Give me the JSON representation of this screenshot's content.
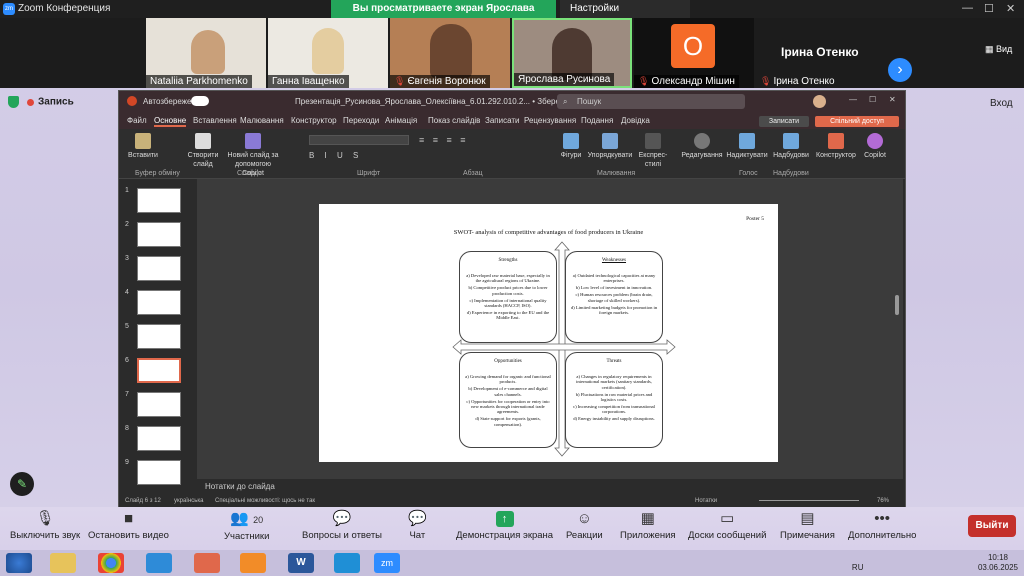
{
  "zoom": {
    "app_title": "Zoom Конференция",
    "share_banner": "Вы просматриваете экран Ярослава Русинова",
    "view_settings": "Настройки просмотра",
    "view_label": "Вид",
    "logo": "zm"
  },
  "participants": [
    {
      "name": "Nataliia Parkhomenko",
      "muted": false
    },
    {
      "name": "Ганна Іващенко",
      "muted": false
    },
    {
      "name": "Євгенія Воронюк",
      "muted": true
    },
    {
      "name": "Ярослава Русинова",
      "muted": false
    },
    {
      "name": "Олександр Мішин",
      "muted": true,
      "avatar_letter": "O"
    },
    {
      "name": "Ірина Отенко",
      "muted": true,
      "big_name": "Ірина Отенко"
    }
  ],
  "recording": {
    "label": "Запись",
    "exit_label": "Вход"
  },
  "ppt": {
    "autosave": "Автозбереження",
    "doc_title": "Презентація_Русинова_Ярослава_Олексіївна_6.01.292.010.2... • Збережено у цей ПК",
    "search": "Пошук",
    "menu": [
      "Файл",
      "Основне",
      "Вставлення",
      "Малювання",
      "Конструктор",
      "Переходи",
      "Анімація",
      "Показ слайдів",
      "Записати",
      "Рецензування",
      "Подання",
      "Довідка"
    ],
    "btn_record": "Записати",
    "btn_share": "Спільний доступ",
    "ribbon": [
      {
        "label": "Вставити"
      },
      {
        "label": "Створити слайд"
      },
      {
        "label": "Новий слайд за допомогою Copilot"
      },
      {
        "label": "Фігури"
      },
      {
        "label": "Упорядкувати"
      },
      {
        "label": "Експрес-стилі"
      },
      {
        "label": "Редагування"
      },
      {
        "label": "Надиктувати"
      },
      {
        "label": "Надбудови"
      },
      {
        "label": "Конструктор"
      },
      {
        "label": "Copilot"
      }
    ],
    "groups": [
      "Буфер обміну",
      "Слайди",
      "Шрифт",
      "Абзац",
      "Малювання",
      "Голос",
      "Надбудови"
    ],
    "slide_numbers": [
      "1",
      "2",
      "3",
      "4",
      "5",
      "6",
      "7",
      "8",
      "9"
    ],
    "notes": "Нотатки до слайда",
    "status_left": "Слайд 6 з 12",
    "status_lang": "українська",
    "status_access": "Спеціальні можливості: щось не так",
    "status_notes": "Нотатки",
    "zoom_pct": "76%"
  },
  "slide": {
    "poster": "Poster 5",
    "title": "SWOT- analysis of competitive advantages of food producers in Ukraine",
    "strengths": {
      "head": "Strengths",
      "items": [
        "a) Developed raw material base, especially in the agricultural regions of Ukraine.",
        "b) Competitive product prices due to lower production costs.",
        "c) Implementation of international quality standards (HACCP, ISO).",
        "d) Experience in exporting to the EU and the Middle East."
      ]
    },
    "weaknesses": {
      "head": "Weaknesses",
      "items": [
        "a) Outdated technological capacities at many enterprises.",
        "b) Low level of investment in innovation.",
        "c) Human resources problem (brain drain, shortage of skilled workers).",
        "d) Limited marketing budgets for promotion in foreign markets."
      ]
    },
    "opportunities": {
      "head": "Opportunities",
      "items": [
        "a) Growing demand for organic and functional products.",
        "b) Development of e-commerce and digital sales channels.",
        "c) Opportunities for cooperation or entry into new markets through international trade agreements.",
        "d) State support for exports (grants, compensation)."
      ]
    },
    "threats": {
      "head": "Threats",
      "items": [
        "a) Changes in regulatory requirements in international markets (sanitary standards, certification).",
        "b) Fluctuations in raw material prices and logistics costs.",
        "c) Increasing competition from transnational corporations.",
        "d) Energy instability and supply disruptions."
      ]
    }
  },
  "toolbar": {
    "mute": "Выключить звук",
    "video": "Остановить видео",
    "participants": "Участники",
    "participants_count": "20",
    "qa": "Вопросы и ответы",
    "chat": "Чат",
    "share": "Демонстрация экрана",
    "reactions": "Реакции",
    "apps": "Приложения",
    "whiteboard": "Доски сообщений",
    "notes": "Примечания",
    "more": "Дополнительно",
    "leave": "Выйти"
  },
  "tray": {
    "lang": "RU",
    "time": "10:18",
    "date": "03.06.2025"
  }
}
